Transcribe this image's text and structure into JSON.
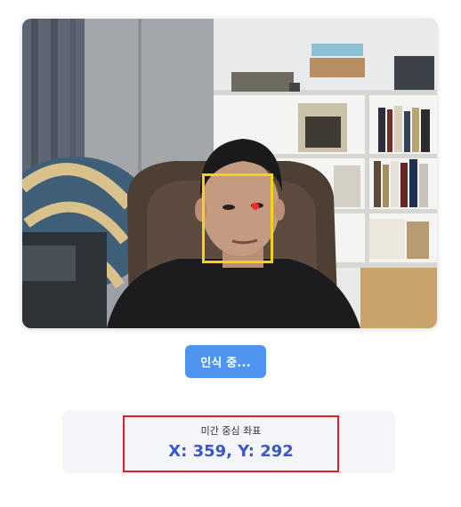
{
  "camera": {
    "face_box_color": "#f3d21a",
    "center_dot_color": "#ff2a2a"
  },
  "status_button": {
    "label": "인식 중...",
    "color": "#4f95ef"
  },
  "coordinates": {
    "title": "미간 중심 좌표",
    "value": "X: 359, Y: 292",
    "value_color": "#3b57c4",
    "highlight_color": "#e01f26"
  }
}
